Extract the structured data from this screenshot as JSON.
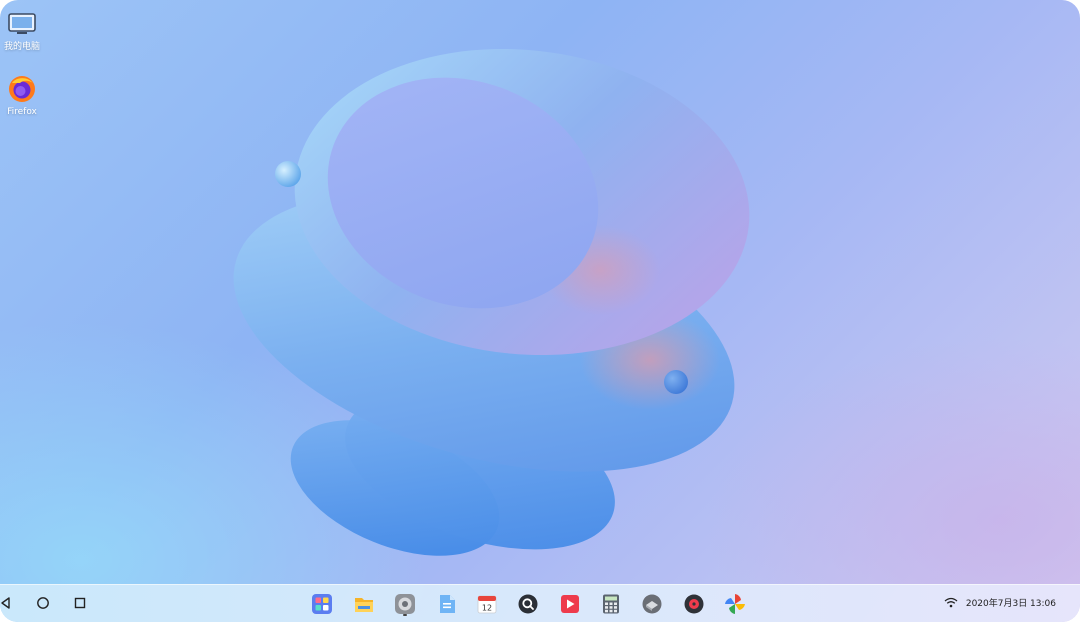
{
  "desktop": {
    "icons": [
      {
        "label": "我的电脑",
        "icon": "computer-icon"
      },
      {
        "label": "Firefox",
        "icon": "firefox-icon"
      }
    ]
  },
  "taskbar": {
    "nav": [
      "back-icon",
      "home-icon",
      "recents-icon"
    ],
    "apps": [
      {
        "name": "app-grid-icon"
      },
      {
        "name": "file-manager-icon"
      },
      {
        "name": "settings-icon",
        "active": true
      },
      {
        "name": "document-icon"
      },
      {
        "name": "calendar-icon",
        "text": "12"
      },
      {
        "name": "search-app-icon"
      },
      {
        "name": "video-player-icon"
      },
      {
        "name": "calculator-icon"
      },
      {
        "name": "installer-icon"
      },
      {
        "name": "music-player-icon"
      },
      {
        "name": "pinwheel-icon"
      }
    ],
    "tray": {
      "wifi": "wifi-icon",
      "clock": "2020年7月3日 13:06"
    }
  },
  "colors": {
    "wallpaper_primary": "#8eb4f4",
    "taskbar": "#d4ecfc"
  }
}
